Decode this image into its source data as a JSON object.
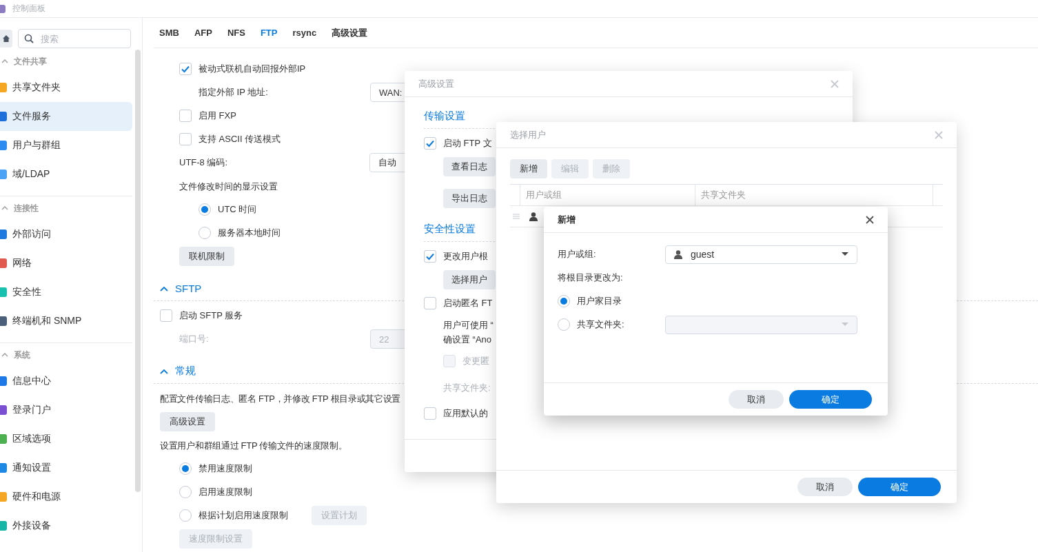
{
  "window": {
    "title": "控制面板"
  },
  "sidebar": {
    "search": {
      "placeholder": "搜索"
    },
    "sections": [
      {
        "title": "文件共享",
        "expanded": true,
        "items": [
          {
            "label": "共享文件夹",
            "color": "#f5a623",
            "selected": false
          },
          {
            "label": "文件服务",
            "color": "#1e6fd9",
            "selected": true
          },
          {
            "label": "用户与群组",
            "color": "#2d8cf0",
            "selected": false
          },
          {
            "label": "域/LDAP",
            "color": "#4aa3f5",
            "selected": false
          }
        ]
      },
      {
        "title": "连接性",
        "expanded": true,
        "items": [
          {
            "label": "外部访问",
            "color": "#1f7ae0",
            "selected": false
          },
          {
            "label": "网络",
            "color": "#e05a4f",
            "selected": false
          },
          {
            "label": "安全性",
            "color": "#19c2b0",
            "selected": false
          },
          {
            "label": "终端机和 SNMP",
            "color": "#4a5f7a",
            "selected": false
          }
        ]
      },
      {
        "title": "系统",
        "expanded": true,
        "items": [
          {
            "label": "信息中心",
            "color": "#1e78e6",
            "selected": false
          },
          {
            "label": "登录门户",
            "color": "#7b4fd1",
            "selected": false
          },
          {
            "label": "区域选项",
            "color": "#4caf50",
            "selected": false
          },
          {
            "label": "通知设置",
            "color": "#1e88e5",
            "selected": false
          },
          {
            "label": "硬件和电源",
            "color": "#f5a623",
            "selected": false
          },
          {
            "label": "外接设备",
            "color": "#17b5a6",
            "selected": false
          }
        ]
      }
    ]
  },
  "tabs": [
    {
      "label": "SMB",
      "selected": false
    },
    {
      "label": "AFP",
      "selected": false
    },
    {
      "label": "NFS",
      "selected": false
    },
    {
      "label": "FTP",
      "selected": true
    },
    {
      "label": "rsync",
      "selected": false
    },
    {
      "label": "高级设置",
      "selected": false
    }
  ],
  "ftp": {
    "items": [
      {
        "kind": "checkbox",
        "label": "被动式联机自动回报外部IP",
        "checked": true,
        "disabled": false,
        "children": [
          {
            "kind": "field",
            "label": "指定外部 IP 地址:",
            "value": "WAN:",
            "disabled": false
          }
        ]
      },
      {
        "kind": "checkbox",
        "label": "启用 FXP",
        "checked": false,
        "disabled": false
      },
      {
        "kind": "checkbox",
        "label": "支持 ASCII 传送模式",
        "checked": false,
        "disabled": false
      },
      {
        "kind": "field",
        "label": "UTF-8 编码:",
        "value": "自动",
        "disabled": false
      },
      {
        "kind": "text",
        "text": "文件修改时间的显示设置",
        "disabled": false,
        "children": [
          {
            "kind": "radio",
            "label": "UTC 时间",
            "selected": true
          },
          {
            "kind": "radio",
            "label": "服务器本地时间",
            "selected": false
          }
        ]
      },
      {
        "kind": "button",
        "label": "联机限制",
        "disabled": false
      }
    ]
  },
  "sections": [
    {
      "title": "SFTP",
      "expanded": true,
      "items": [
        {
          "kind": "checkbox",
          "label": "启动 SFTP 服务",
          "checked": false,
          "disabled": false,
          "children": [
            {
              "kind": "field",
              "label": "端口号:",
              "value": "22",
              "disabled": true
            }
          ]
        }
      ]
    },
    {
      "title": "常规",
      "expanded": true,
      "items": [
        {
          "kind": "text",
          "text": "配置文件传输日志、匿名 FTP，并修改 FTP 根目录或其它设置",
          "disabled": false
        },
        {
          "kind": "button",
          "label": "高级设置",
          "disabled": false
        },
        {
          "kind": "text",
          "text": "设置用户和群组通过 FTP 传输文件的速度限制。",
          "disabled": false,
          "children": [
            {
              "kind": "radio",
              "label": "禁用速度限制",
              "selected": true
            },
            {
              "kind": "radio",
              "label": "启用速度限制",
              "selected": false
            },
            {
              "kind": "radio",
              "label": "根据计划启用速度限制",
              "selected": false,
              "button": {
                "label": "设置计划",
                "disabled": true
              }
            },
            {
              "kind": "button",
              "label": "速度限制设置",
              "disabled": true
            }
          ]
        }
      ]
    }
  ],
  "advanced_dialog": {
    "title": "高级设置",
    "active": false,
    "sections": [
      {
        "title": "传输设置",
        "items": [
          {
            "kind": "checkbox",
            "label": "启动 FTP 文",
            "checked": true,
            "disabled": false,
            "children": [
              {
                "kind": "button",
                "label": "查看日志",
                "disabled": false
              },
              {
                "kind": "button",
                "label": "导出日志",
                "disabled": false
              }
            ]
          }
        ]
      },
      {
        "title": "安全性设置",
        "items": [
          {
            "kind": "checkbox",
            "label": "更改用户根",
            "checked": true,
            "disabled": false,
            "children": [
              {
                "kind": "button",
                "label": "选择用户",
                "disabled": false
              }
            ]
          },
          {
            "kind": "checkbox",
            "label": "启动匿名 FT",
            "checked": false,
            "disabled": false,
            "children": [
              {
                "kind": "text",
                "text": "用户可使用 “\n确设置 “Ano",
                "disabled": false
              },
              {
                "kind": "checkbox",
                "label": "变更匿",
                "checked": false,
                "disabled": true
              },
              {
                "kind": "text",
                "text": "共享文件夹:",
                "disabled": true
              }
            ]
          },
          {
            "kind": "checkbox",
            "label": "应用默认的",
            "checked": false,
            "disabled": false
          }
        ]
      }
    ]
  },
  "select_user_dialog": {
    "title": "选择用户",
    "active": false,
    "toolbar": [
      {
        "label": "新增",
        "disabled": false
      },
      {
        "label": "编辑",
        "disabled": true
      },
      {
        "label": "删除",
        "disabled": true
      }
    ],
    "columns": [
      "用户或组",
      "共享文件夹"
    ],
    "rows": [
      {
        "kind": "user"
      }
    ],
    "buttons": [
      {
        "label": "取消",
        "kind": "secondary"
      },
      {
        "label": "确定",
        "kind": "primary"
      }
    ]
  },
  "add_dialog": {
    "title": "新增",
    "active": true,
    "user_field": {
      "label": "用户或组:",
      "value": "guest"
    },
    "root_label": "将根目录更改为:",
    "options": [
      {
        "label": "用户家目录",
        "selected": true
      },
      {
        "label": "共享文件夹:",
        "selected": false,
        "dropdown": {
          "disabled": true
        }
      }
    ],
    "buttons": [
      {
        "label": "取消",
        "kind": "secondary"
      },
      {
        "label": "确定",
        "kind": "primary"
      }
    ]
  }
}
